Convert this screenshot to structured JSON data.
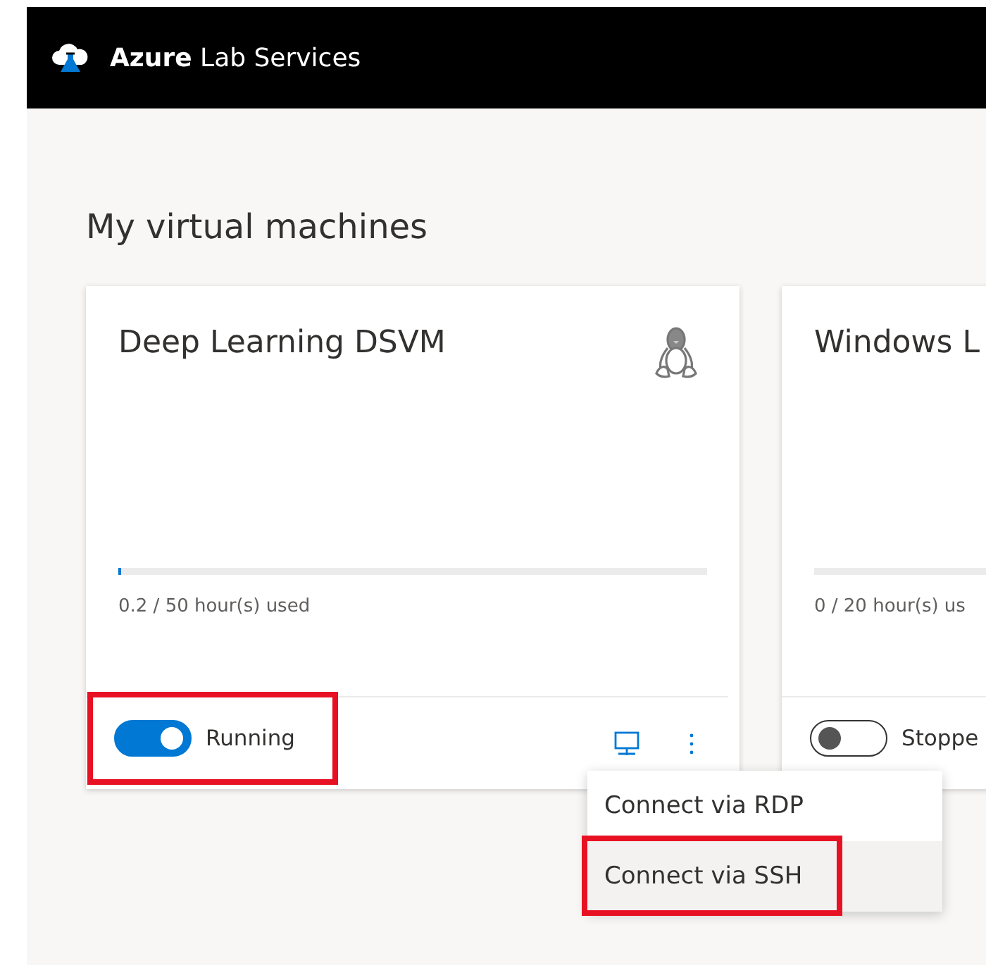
{
  "header": {
    "brand_bold": "Azure",
    "brand_rest": "Lab Services"
  },
  "page_title": "My virtual machines",
  "cards": [
    {
      "name": "Deep Learning DSVM",
      "kind": "linux",
      "level": 0.004,
      "usage": "0.2 / 50 hour(s) used",
      "on": true,
      "status": "Running",
      "highlighted": true,
      "actions": true,
      "menu": {
        "items": [
          {
            "label": "Connect via RDP",
            "selected": false,
            "highlighted": false
          },
          {
            "label": "Connect via SSH",
            "selected": true,
            "highlighted": true
          }
        ]
      }
    },
    {
      "name": "Windows L",
      "kind": "plain",
      "level": 0,
      "usage": "0 / 20 hour(s) us",
      "on": false,
      "status": "Stoppe",
      "highlighted": false,
      "actions": false
    }
  ]
}
